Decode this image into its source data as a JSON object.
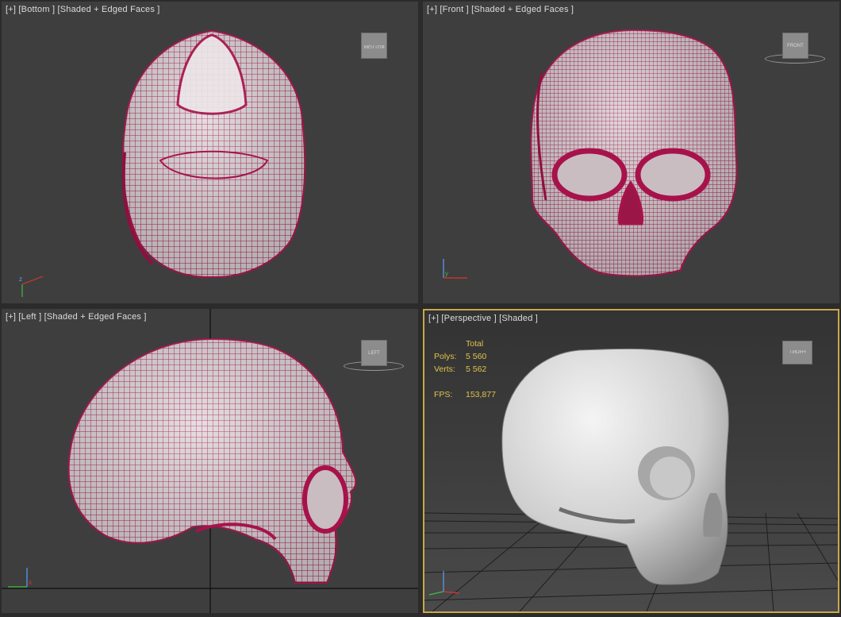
{
  "viewports": {
    "bottom": {
      "plus": "[+]",
      "view": "[Bottom ]",
      "mode": "[Shaded + Edged Faces ]",
      "cube": "BOTTOM"
    },
    "front": {
      "plus": "[+]",
      "view": "[Front ]",
      "mode": "[Shaded + Edged Faces ]",
      "cube": "FRONT"
    },
    "left": {
      "plus": "[+]",
      "view": "[Left ]",
      "mode": "[Shaded + Edged Faces ]",
      "cube": "LEFT"
    },
    "perspective": {
      "plus": "[+]",
      "view": "[Perspective ]",
      "mode": "[Shaded ]",
      "cube": "FRONT"
    }
  },
  "stats": {
    "header": "Total",
    "polys_label": "Polys:",
    "polys_value": "5 560",
    "verts_label": "Verts:",
    "verts_value": "5 562",
    "fps_label": "FPS:",
    "fps_value": "153,877"
  },
  "colors": {
    "wire": "#b0124e",
    "surface": "#ddd3d6",
    "active_border": "#c8a84a",
    "stats_text": "#e2c24d"
  }
}
